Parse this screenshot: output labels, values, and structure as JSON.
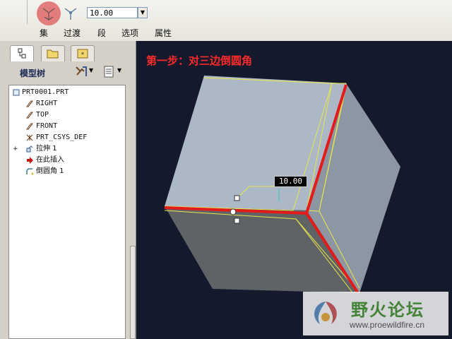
{
  "dashboard": {
    "radius_value": "10.00",
    "tabs": [
      "集",
      "过渡",
      "段",
      "选项",
      "属性"
    ]
  },
  "left_panel": {
    "title": "模型树",
    "tree": [
      {
        "label": "PRT0001.PRT",
        "icon": "part-icon"
      },
      {
        "label": "RIGHT",
        "icon": "datum-plane-icon"
      },
      {
        "label": "TOP",
        "icon": "datum-plane-icon"
      },
      {
        "label": "FRONT",
        "icon": "datum-plane-icon"
      },
      {
        "label": "PRT_CSYS_DEF",
        "icon": "csys-icon"
      },
      {
        "label": "拉伸 1",
        "icon": "extrude-icon"
      },
      {
        "label": "在此插入",
        "icon": "insert-arrow-icon"
      },
      {
        "label": "倒圆角 1",
        "icon": "round-icon"
      }
    ]
  },
  "viewport": {
    "caption": "第一步：对三边倒圆角",
    "dimension": "10.00"
  },
  "watermark": {
    "name": "野火论坛",
    "url": "www.proewildfire.cn"
  },
  "colors": {
    "edge_highlight": "#e31b1b",
    "viewport_bg": "#141a2c",
    "caption": "#ff2a2a",
    "watermark_green": "#4e9a3a"
  }
}
